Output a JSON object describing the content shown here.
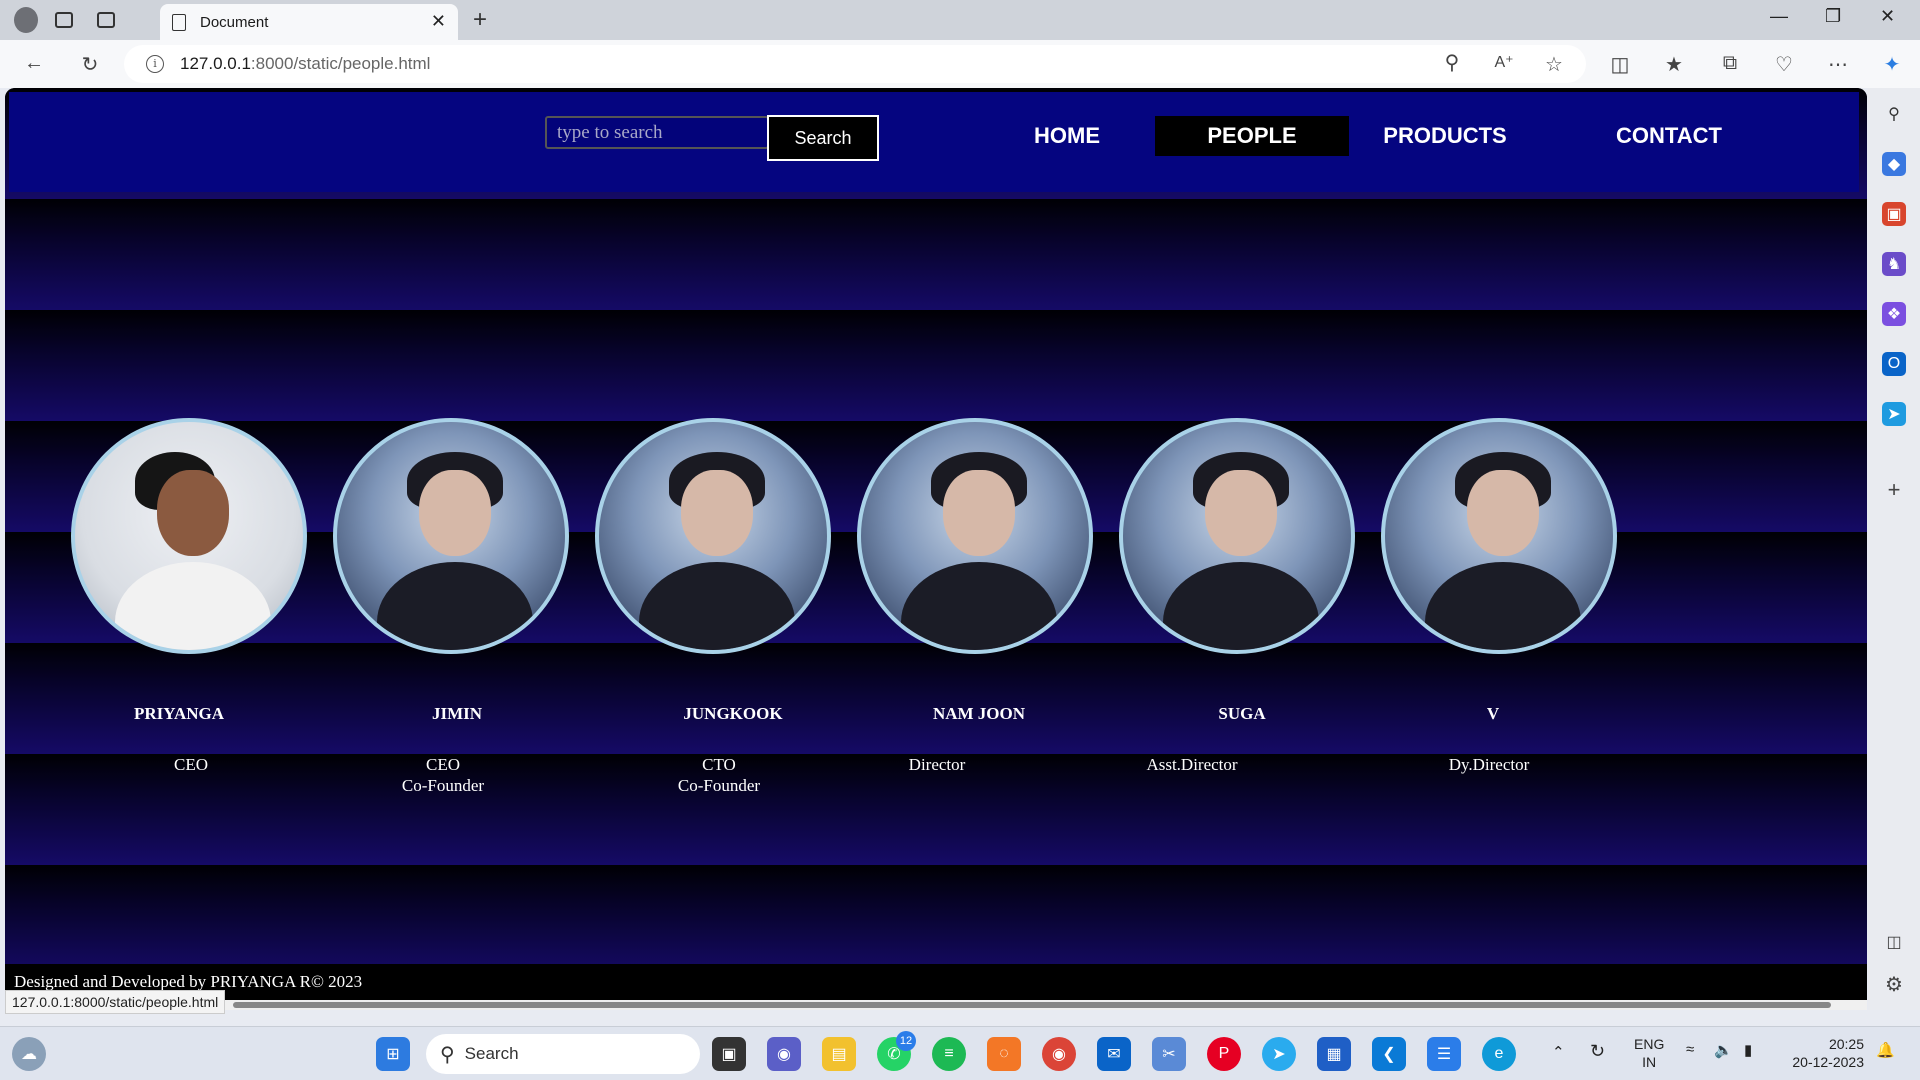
{
  "browser": {
    "tab_title": "Document",
    "new_tab_symbol": "+",
    "close_symbol": "✕",
    "url_host": "127.0.0.1",
    "url_path": ":8000/static/people.html",
    "status_url": "127.0.0.1:8000/static/people.html"
  },
  "header": {
    "search_placeholder": "type to search",
    "search_button": "Search",
    "nav": [
      {
        "label": "HOME"
      },
      {
        "label": "PEOPLE"
      },
      {
        "label": "PRODUCTS"
      },
      {
        "label": "CONTACT"
      }
    ]
  },
  "people": [
    {
      "name": "PRIYANGA",
      "role": "CEO"
    },
    {
      "name": "JIMIN",
      "role": "CEO\nCo-Founder"
    },
    {
      "name": "JUNGKOOK",
      "role": "CTO\nCo-Founder"
    },
    {
      "name": "NAM JOON",
      "role": "Director"
    },
    {
      "name": "SUGA",
      "role": "Asst.Director"
    },
    {
      "name": "V",
      "role": "Dy.Director"
    }
  ],
  "footer": {
    "text": "Designed and Developed by PRIYANGA R© 2023"
  },
  "taskbar": {
    "search_label": "Search",
    "whatsapp_badge": "12",
    "lang_top": "ENG",
    "lang_bottom": "IN",
    "time": "20:25",
    "date": "20-12-2023"
  }
}
